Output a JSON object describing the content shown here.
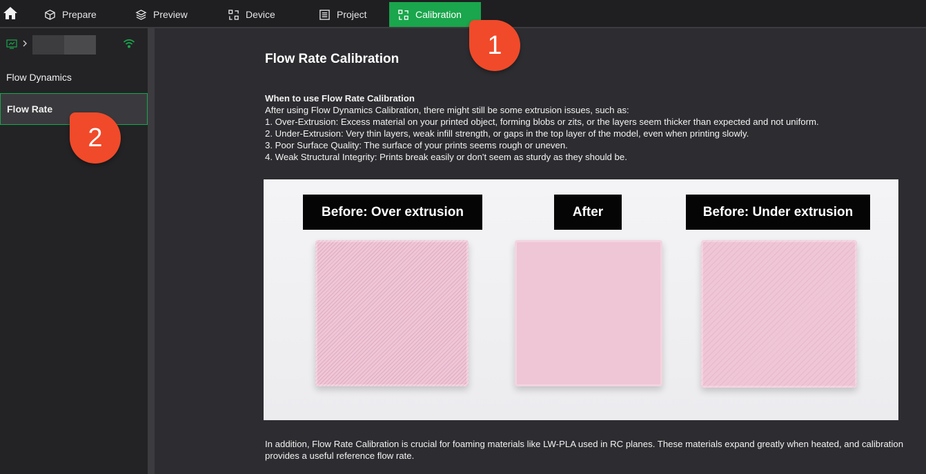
{
  "topbar": {
    "tabs": [
      {
        "label": "Prepare",
        "icon": "cube-icon"
      },
      {
        "label": "Preview",
        "icon": "layers-icon"
      },
      {
        "label": "Device",
        "icon": "device-icon"
      },
      {
        "label": "Project",
        "icon": "project-list-icon"
      },
      {
        "label": "Calibration",
        "icon": "calibration-icon"
      }
    ],
    "accent": "#1aa64c"
  },
  "sidebar": {
    "items": [
      {
        "label": "Flow Dynamics"
      },
      {
        "label": "Flow Rate"
      }
    ],
    "wifi_color": "#1aa64c"
  },
  "main": {
    "title": "Flow Rate Calibration",
    "section_heading": "When to use Flow Rate Calibration",
    "intro": "After using Flow Dynamics Calibration, there might still be some extrusion issues, such as:",
    "issues": [
      "1. Over-Extrusion: Excess material on your printed object, forming blobs or zits, or the layers seem thicker than expected and not uniform.",
      "2. Under-Extrusion: Very thin layers, weak infill strength, or gaps in the top layer of the model, even when printing slowly.",
      "3. Poor Surface Quality: The surface of your prints seems rough or uneven.",
      "4. Weak Structural Integrity: Prints break easily or don't seem as sturdy as they should be."
    ],
    "photo_labels": [
      "Before: Over extrusion",
      "After",
      "Before: Under extrusion"
    ],
    "footer": "In addition, Flow Rate Calibration is crucial for foaming materials like LW-PLA used in RC planes. These materials expand greatly when heated, and calibration provides a useful reference flow rate."
  },
  "annotations": {
    "badge_1": "1",
    "badge_2": "2",
    "badge_color": "#f04a2a"
  }
}
